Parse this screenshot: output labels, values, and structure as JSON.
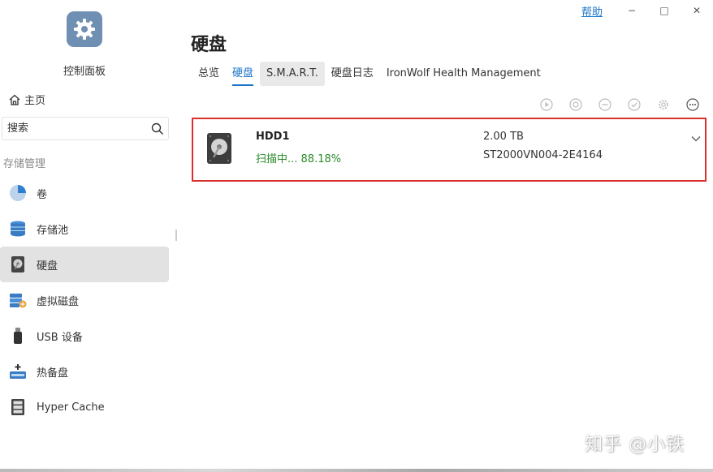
{
  "window": {
    "help_label": "帮助",
    "minimize_glyph": "−",
    "maximize_glyph": "□",
    "close_glyph": "✕"
  },
  "sidebar": {
    "app_label": "控制面板",
    "app_icon": "control-panel-gear-icon",
    "home_label": "主页",
    "search_placeholder": "搜索",
    "section_label": "存储管理",
    "items": [
      {
        "label": "卷",
        "icon": "volume-pie-icon",
        "active": false
      },
      {
        "label": "存储池",
        "icon": "storage-pool-icon",
        "active": false
      },
      {
        "label": "硬盘",
        "icon": "hard-disk-icon",
        "active": true
      },
      {
        "label": "虚拟磁盘",
        "icon": "virtual-disk-icon",
        "active": false
      },
      {
        "label": "USB 设备",
        "icon": "usb-icon",
        "active": false
      },
      {
        "label": "热备盘",
        "icon": "hot-spare-icon",
        "active": false
      },
      {
        "label": "Hyper Cache",
        "icon": "hyper-cache-icon",
        "active": false
      }
    ]
  },
  "main": {
    "title": "硬盘",
    "tabs": [
      {
        "label": "总览",
        "active": false
      },
      {
        "label": "硬盘",
        "active": true
      },
      {
        "label": "S.M.A.R.T.",
        "active": false,
        "hover": true
      },
      {
        "label": "硬盘日志",
        "active": false
      },
      {
        "label": "IronWolf Health Management",
        "active": false
      }
    ],
    "toolbar_icons": [
      "play-icon",
      "target-icon",
      "minus-circle-icon",
      "check-circle-icon",
      "gear-icon",
      "more-icon"
    ],
    "disk": {
      "name": "HDD1",
      "status": "扫描中... 88.18%",
      "size": "2.00 TB",
      "model": "ST2000VN004-2E4164"
    }
  },
  "colors": {
    "accent": "#1a73c8",
    "status_green": "#2a8a2a",
    "highlight_border": "#d9302c",
    "active_nav_bg": "#e2e2e2"
  },
  "watermark": "知乎 @小铁"
}
